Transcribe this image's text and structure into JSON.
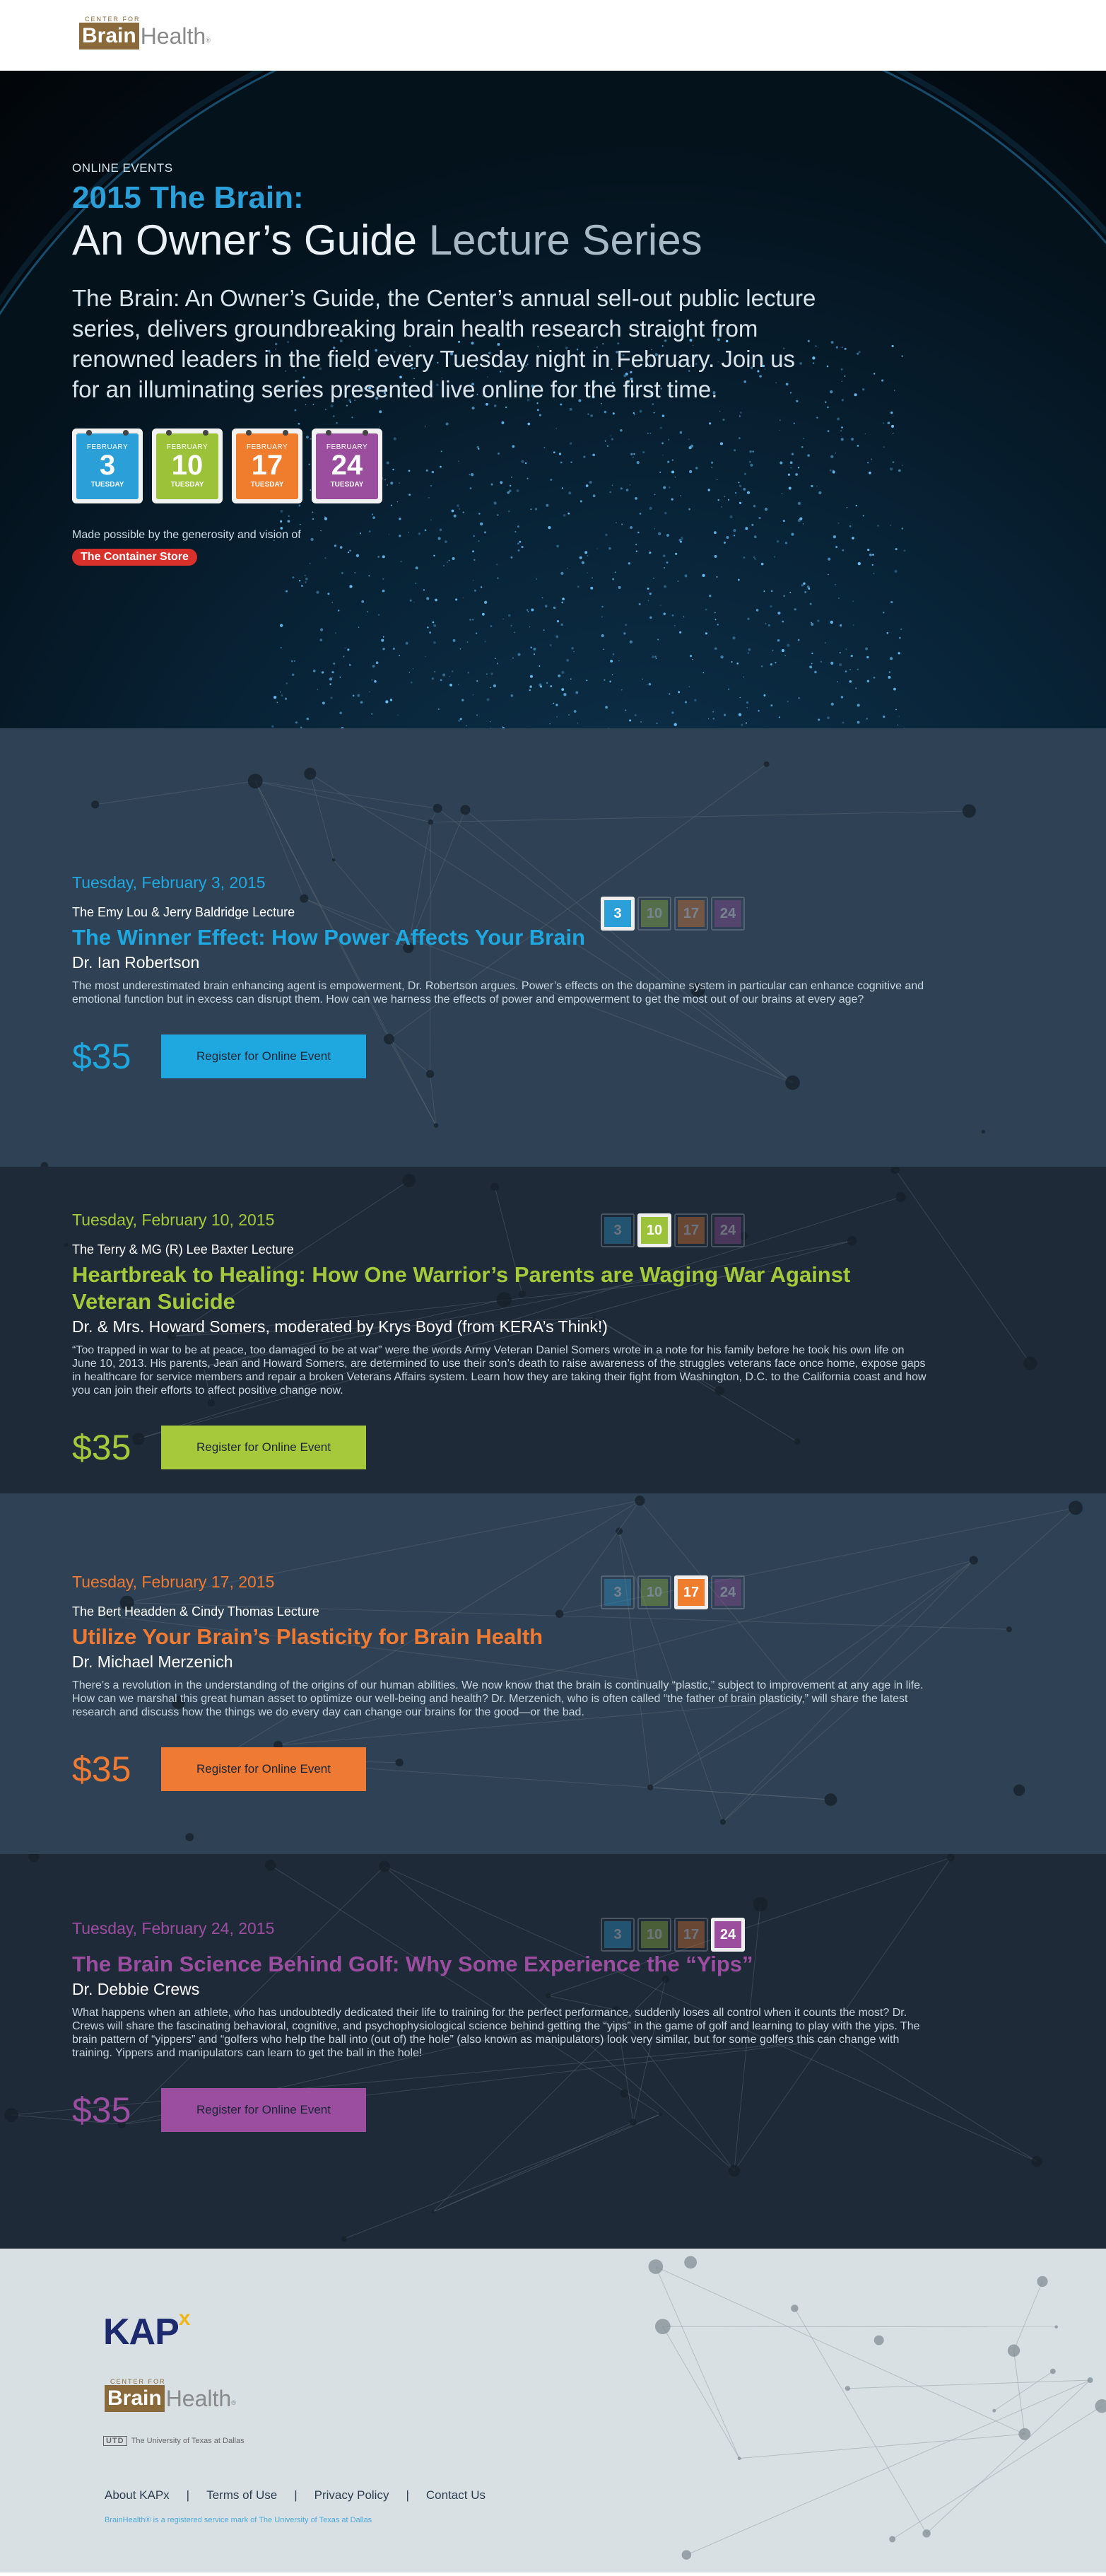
{
  "header": {
    "logo_small": "CENTER FOR",
    "logo_brain": "Brain",
    "logo_health": "Health",
    "logo_reg": "®"
  },
  "hero": {
    "eyebrow": "ONLINE EVENTS",
    "title_line1": "2015 The Brain:",
    "title_line2_a": "An Owner’s Guide",
    "title_line2_b": "Lecture Series",
    "description": "The Brain: An Owner’s Guide, the Center’s annual sell-out public lecture series, delivers groundbreaking brain health research straight from renowned leaders in the field every Tuesday night in February. Join us for an illuminating series presented live online for the first time.",
    "calendars": [
      {
        "month": "FEBRUARY",
        "day": "3",
        "dow": "TUESDAY",
        "color": "#2a9fd8"
      },
      {
        "month": "FEBRUARY",
        "day": "10",
        "dow": "TUESDAY",
        "color": "#9cc23a"
      },
      {
        "month": "FEBRUARY",
        "day": "17",
        "dow": "TUESDAY",
        "color": "#ef7d2d"
      },
      {
        "month": "FEBRUARY",
        "day": "24",
        "dow": "TUESDAY",
        "color": "#9b4e9e"
      }
    ],
    "made_possible": "Made possible by the generosity and vision of",
    "sponsor": "The Container Store"
  },
  "events": [
    {
      "date": "Tuesday, February 3, 2015",
      "lecture": "The Emy Lou & Jerry Baldridge Lecture",
      "title": "The Winner Effect: How Power Affects Your Brain",
      "speaker": "Dr. Ian Robertson",
      "description": "The most underestimated brain enhancing agent is empowerment, Dr. Robertson argues. Power’s effects on the dopamine system in particular can enhance cognitive and emotional function but in excess can disrupt them. How can we harness the effects of power and empowerment to get the most out of our brains at every age?",
      "price": "$35",
      "button": "Register for Online Event",
      "color": "#1fa8df",
      "active_index": 0
    },
    {
      "date": "Tuesday, February 10, 2015",
      "lecture": "The Terry & MG (R) Lee Baxter Lecture",
      "title": "Heartbreak to Healing: How One Warrior’s Parents are Waging War Against Veteran Suicide",
      "speaker": "Dr. & Mrs. Howard Somers, moderated by Krys Boyd (from KERA’s Think!)",
      "description": "“Too trapped in war to be at peace, too damaged to be at war” were the words Army Veteran Daniel Somers wrote in a note for his family before he took his own life on June 10, 2013. His parents, Jean and Howard Somers, are determined to use their son’s death to raise awareness of the struggles veterans face once home, expose gaps in healthcare for service members and repair a broken Veterans Affairs system. Learn how they are taking their fight from Washington, D.C. to the California coast and how you can join their efforts to affect positive change now.",
      "price": "$35",
      "button": "Register for Online Event",
      "color": "#a5c93b",
      "active_index": 1
    },
    {
      "date": "Tuesday, February 17, 2015",
      "lecture": "The Bert Headden & Cindy Thomas Lecture",
      "title": "Utilize Your Brain’s Plasticity for Brain Health",
      "speaker": "Dr. Michael Merzenich",
      "description": "There’s a revolution in the understanding of the origins of our human abilities. We now know that the brain is continually “plastic,” subject to improvement at any age in life. How can we marshal this great human asset to optimize our well-being and health? Dr. Merzenich, who is often called “the father of brain plasticity,” will share the latest research and discuss how the things we do every day can change our brains for the good—or the bad.",
      "price": "$35",
      "button": "Register for Online Event",
      "color": "#ee7a33",
      "active_index": 2
    },
    {
      "date": "Tuesday, February 24, 2015",
      "lecture": "",
      "title": "The Brain Science Behind Golf: Why Some Experience the “Yips”",
      "speaker": "Dr. Debbie Crews",
      "description": "What happens when an athlete, who has undoubtedly dedicated their life to training for the perfect performance, suddenly loses all control when it counts the most? Dr. Crews will share the fascinating behavioral, cognitive, and psychophysiological science behind getting the “yips” in the game of golf and learning to play with the yips. The brain pattern of “yippers” and “golfers who help the ball into (out of) the hole” (also known as manipulators) look very similar, but for some golfers this can change with training. Yippers and manipulators can learn to get the ball in the hole!",
      "price": "$35",
      "button": "Register for Online Event",
      "color": "#9b4ea0",
      "active_index": 3
    }
  ],
  "mini_days": [
    "3",
    "10",
    "17",
    "24"
  ],
  "footer": {
    "kapx": "KAP",
    "kapx_sup": "x",
    "logo_small": "CENTER FOR",
    "logo_brain": "Brain",
    "logo_health": "Health",
    "logo_reg": "®",
    "utd_box": "UTD",
    "utd_text": "The University of Texas at Dallas",
    "links": [
      "About KAPx",
      "Terms of Use",
      "Privacy Policy",
      "Contact Us"
    ],
    "note": "BrainHealth® is a registered service mark of The University of Texas at Dallas"
  }
}
